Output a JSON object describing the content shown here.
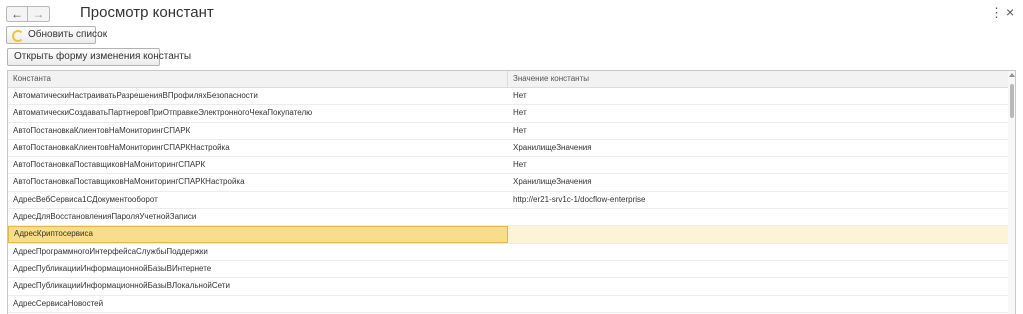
{
  "window": {
    "title": "Просмотр констант",
    "nav_back_icon": "←",
    "nav_forward_icon": "→",
    "more_icon": "⋮",
    "close_icon": "×"
  },
  "toolbar": {
    "refresh_label": "Обновить список",
    "open_form_label": "Открыть форму изменения константы"
  },
  "table": {
    "columns": [
      "Константа",
      "Значение константы"
    ],
    "rows": [
      {
        "name": "АвтоматическиНастраиватьРазрешенияВПрофиляхБезопасности",
        "value": "Нет"
      },
      {
        "name": "АвтоматическиСоздаватьПартнеровПриОтправкеЭлектронногоЧекаПокупателю",
        "value": "Нет"
      },
      {
        "name": "АвтоПостановкаКлиентовНаМониторингСПАРК",
        "value": "Нет"
      },
      {
        "name": "АвтоПостановкаКлиентовНаМониторингСПАРКНастройка",
        "value": "ХранилищеЗначения"
      },
      {
        "name": "АвтоПостановкаПоставщиковНаМониторингСПАРК",
        "value": "Нет"
      },
      {
        "name": "АвтоПостановкаПоставщиковНаМониторингСПАРКНастройка",
        "value": "ХранилищеЗначения"
      },
      {
        "name": "АдресВебСервиса1СДокументооборот",
        "value": "http://er21-srv1c-1/docflow-enterprise"
      },
      {
        "name": "АдресДляВосстановленияПароляУчетнойЗаписи",
        "value": ""
      },
      {
        "name": "АдресКриптосервиса",
        "value": ""
      },
      {
        "name": "АдресПрограммногоИнтерфейсаСлужбыПоддержки",
        "value": ""
      },
      {
        "name": "АдресПубликацииИнформационнойБазыВИнтернете",
        "value": ""
      },
      {
        "name": "АдресПубликацииИнформационнойБазыВЛокальнойСети",
        "value": ""
      },
      {
        "name": "АдресСервисаНовостей",
        "value": ""
      }
    ]
  },
  "colors": {
    "selection": "#f8dd8a",
    "selection_row": "#fbefc4",
    "refresh_icon": "#f0c531"
  }
}
